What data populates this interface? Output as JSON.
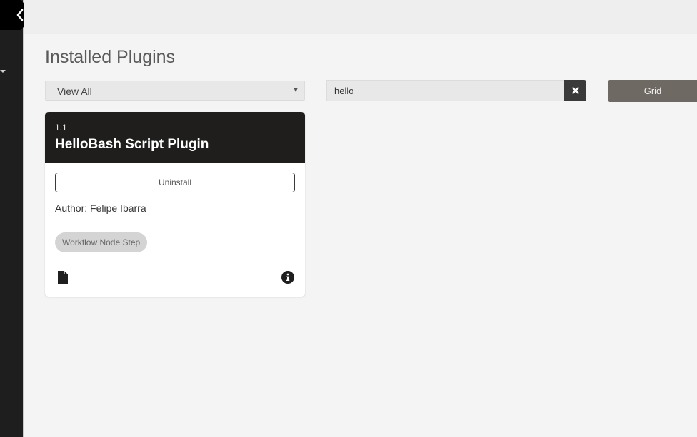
{
  "sidebar": {
    "toggle_icon": "chevron-left-icon",
    "caret_icon": "caret-down-icon"
  },
  "header": {
    "title": "Installed Plugins"
  },
  "filter": {
    "selected": "View All"
  },
  "search": {
    "value": "hello",
    "clear_icon": "close-icon"
  },
  "view_toggle": {
    "label": "Grid"
  },
  "plugins": [
    {
      "version": "1.1",
      "name": "HelloBash Script Plugin",
      "uninstall_label": "Uninstall",
      "author": "Author: Felipe Ibarra",
      "tag": "Workflow Node Step",
      "icons": [
        "file-icon",
        "info-icon"
      ]
    }
  ],
  "colors": {
    "sidebar": "#1e1e1e",
    "card_header": "#1f1e1d",
    "grid_button": "#6e6a63",
    "clear_button": "#3a3a3a"
  }
}
